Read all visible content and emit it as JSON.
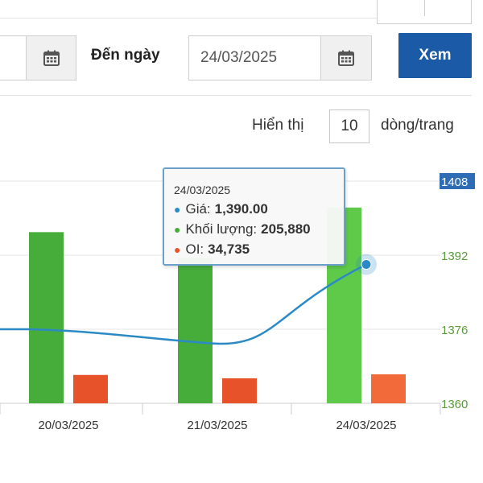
{
  "filters": {
    "to_label": "Đến ngày",
    "to_value": "24/03/2025",
    "view_button": "Xem",
    "calendar_icon": "calendar-icon"
  },
  "pagination": {
    "show_label": "Hiển thị",
    "rows_per_page": "10",
    "per_label": "dòng/trang"
  },
  "tooltip": {
    "date": "24/03/2025",
    "price_label": "Giá:",
    "price_value": "1,390.00",
    "volume_label": "Khối lượng:",
    "volume_value": "205,880",
    "oi_label": "OI:",
    "oi_value": "34,735"
  },
  "chart_data": {
    "type": "bar",
    "categories": [
      "20/03/2025",
      "21/03/2025",
      "24/03/2025"
    ],
    "y_axis_right": {
      "ticks": [
        "1360",
        "1376",
        "1392",
        "1408"
      ],
      "range": [
        1360,
        1408
      ],
      "highlight_tick": "1408"
    },
    "series": [
      {
        "name": "Giá",
        "type": "line",
        "values": [
          1376.0,
          1375.5,
          1390.0
        ]
      },
      {
        "name": "Khối lượng",
        "type": "bar",
        "values": [
          180000,
          153000,
          205880
        ]
      },
      {
        "name": "OI",
        "type": "bar",
        "values": [
          34000,
          30000,
          34735
        ]
      }
    ],
    "colors": {
      "price": "#2b8ac6",
      "volume": "#46ac3a",
      "volume_highlight": "#5fc94a",
      "oi": "#e8522a",
      "oi_highlight": "#f26a3a",
      "axis_text": "#5a9a3a",
      "grid": "#e6e6e6"
    },
    "grid": true,
    "highlighted_category": "24/03/2025"
  }
}
